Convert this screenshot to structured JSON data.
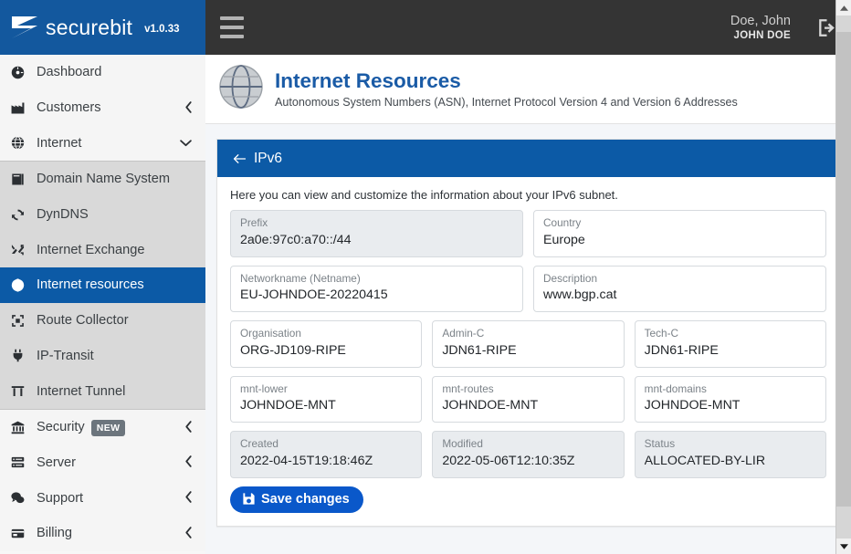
{
  "brand": {
    "name": "securebit",
    "version": "v1.0.33",
    "logo_icon": "securebit-logo-icon"
  },
  "topbar": {
    "menu_icon": "hamburger-menu-icon",
    "user_name": "Doe, John",
    "user_role": "JOHN DOE",
    "logout_icon": "logout-icon"
  },
  "sidebar": {
    "groups": [
      {
        "id": "top",
        "items": [
          {
            "label": "Dashboard",
            "icon": "dashboard-icon",
            "caret": "",
            "active": false
          },
          {
            "label": "Customers",
            "icon": "customers-icon",
            "caret": "‹",
            "active": false
          },
          {
            "label": "Internet",
            "icon": "globe-icon",
            "caret": "˅",
            "active": false
          }
        ]
      },
      {
        "id": "internet-submenu",
        "items": [
          {
            "label": "Domain Name System",
            "icon": "book-icon",
            "caret": "",
            "active": false
          },
          {
            "label": "DynDNS",
            "icon": "refresh-icon",
            "caret": "",
            "active": false
          },
          {
            "label": "Internet Exchange",
            "icon": "exchange-icon",
            "caret": "",
            "active": false
          },
          {
            "label": "Internet resources",
            "icon": "globe-icon",
            "caret": "",
            "active": true
          },
          {
            "label": "Route Collector",
            "icon": "compress-icon",
            "caret": "",
            "active": false
          },
          {
            "label": "IP-Transit",
            "icon": "plug-icon",
            "caret": "",
            "active": false
          },
          {
            "label": "Internet Tunnel",
            "icon": "tunnel-icon",
            "caret": "",
            "active": false
          }
        ]
      },
      {
        "id": "bottom",
        "items": [
          {
            "label": "Security",
            "icon": "bank-icon",
            "caret": "‹",
            "badge": "NEW",
            "active": false
          },
          {
            "label": "Server",
            "icon": "server-icon",
            "caret": "‹",
            "active": false
          },
          {
            "label": "Support",
            "icon": "comments-icon",
            "caret": "‹",
            "active": false
          },
          {
            "label": "Billing",
            "icon": "credit-card-icon",
            "caret": "‹",
            "active": false
          }
        ]
      }
    ]
  },
  "page": {
    "icon": "globe-large-icon",
    "title": "Internet Resources",
    "subtitle": "Autonomous System Numbers (ASN), Internet Protocol Version 4 and Version 6 Addresses"
  },
  "card": {
    "back_icon": "back-arrow-icon",
    "title": "IPv6",
    "helper": "Here you can view and customize the information about your IPv6 subnet.",
    "rows": [
      {
        "fields": [
          {
            "label": "Prefix",
            "value": "2a0e:97c0:a70::/44",
            "disabled": true,
            "flex": 1
          },
          {
            "label": "Country",
            "value": "Europe",
            "disabled": false,
            "flex": 1
          }
        ]
      },
      {
        "fields": [
          {
            "label": "Networkname (Netname)",
            "value": "EU-JOHNDOE-20220415",
            "disabled": false,
            "flex": 1
          },
          {
            "label": "Description",
            "value": "www.bgp.cat",
            "disabled": false,
            "flex": 1
          }
        ]
      },
      {
        "fields": [
          {
            "label": "Organisation",
            "value": "ORG-JD109-RIPE",
            "disabled": false,
            "flex": 1
          },
          {
            "label": "Admin-C",
            "value": "JDN61-RIPE",
            "disabled": false,
            "flex": 1
          },
          {
            "label": "Tech-C",
            "value": "JDN61-RIPE",
            "disabled": false,
            "flex": 1
          }
        ]
      },
      {
        "fields": [
          {
            "label": "mnt-lower",
            "value": "JOHNDOE-MNT",
            "disabled": false,
            "flex": 1
          },
          {
            "label": "mnt-routes",
            "value": "JOHNDOE-MNT",
            "disabled": false,
            "flex": 1
          },
          {
            "label": "mnt-domains",
            "value": "JOHNDOE-MNT",
            "disabled": false,
            "flex": 1
          }
        ]
      },
      {
        "fields": [
          {
            "label": "Created",
            "value": "2022-04-15T19:18:46Z",
            "disabled": true,
            "flex": 1
          },
          {
            "label": "Modified",
            "value": "2022-05-06T12:10:35Z",
            "disabled": true,
            "flex": 1
          },
          {
            "label": "Status",
            "value": "ALLOCATED-BY-LIR",
            "disabled": true,
            "flex": 1
          }
        ]
      }
    ],
    "save_label": "Save changes",
    "save_icon": "save-floppy-icon"
  },
  "scrollbar": {
    "up_icon": "chevron-up-icon",
    "down_icon": "chevron-down-icon"
  },
  "colors": {
    "brand_blue": "#13589e",
    "accent_blue": "#0c5aa6",
    "title_blue": "#1a5ba6",
    "topbar_dark": "#343434",
    "sidebar_light": "#f5f5f5",
    "sidebar_sub": "#d9d9d9",
    "badge_gray": "#6c757d",
    "button_blue": "#0a58ca"
  }
}
